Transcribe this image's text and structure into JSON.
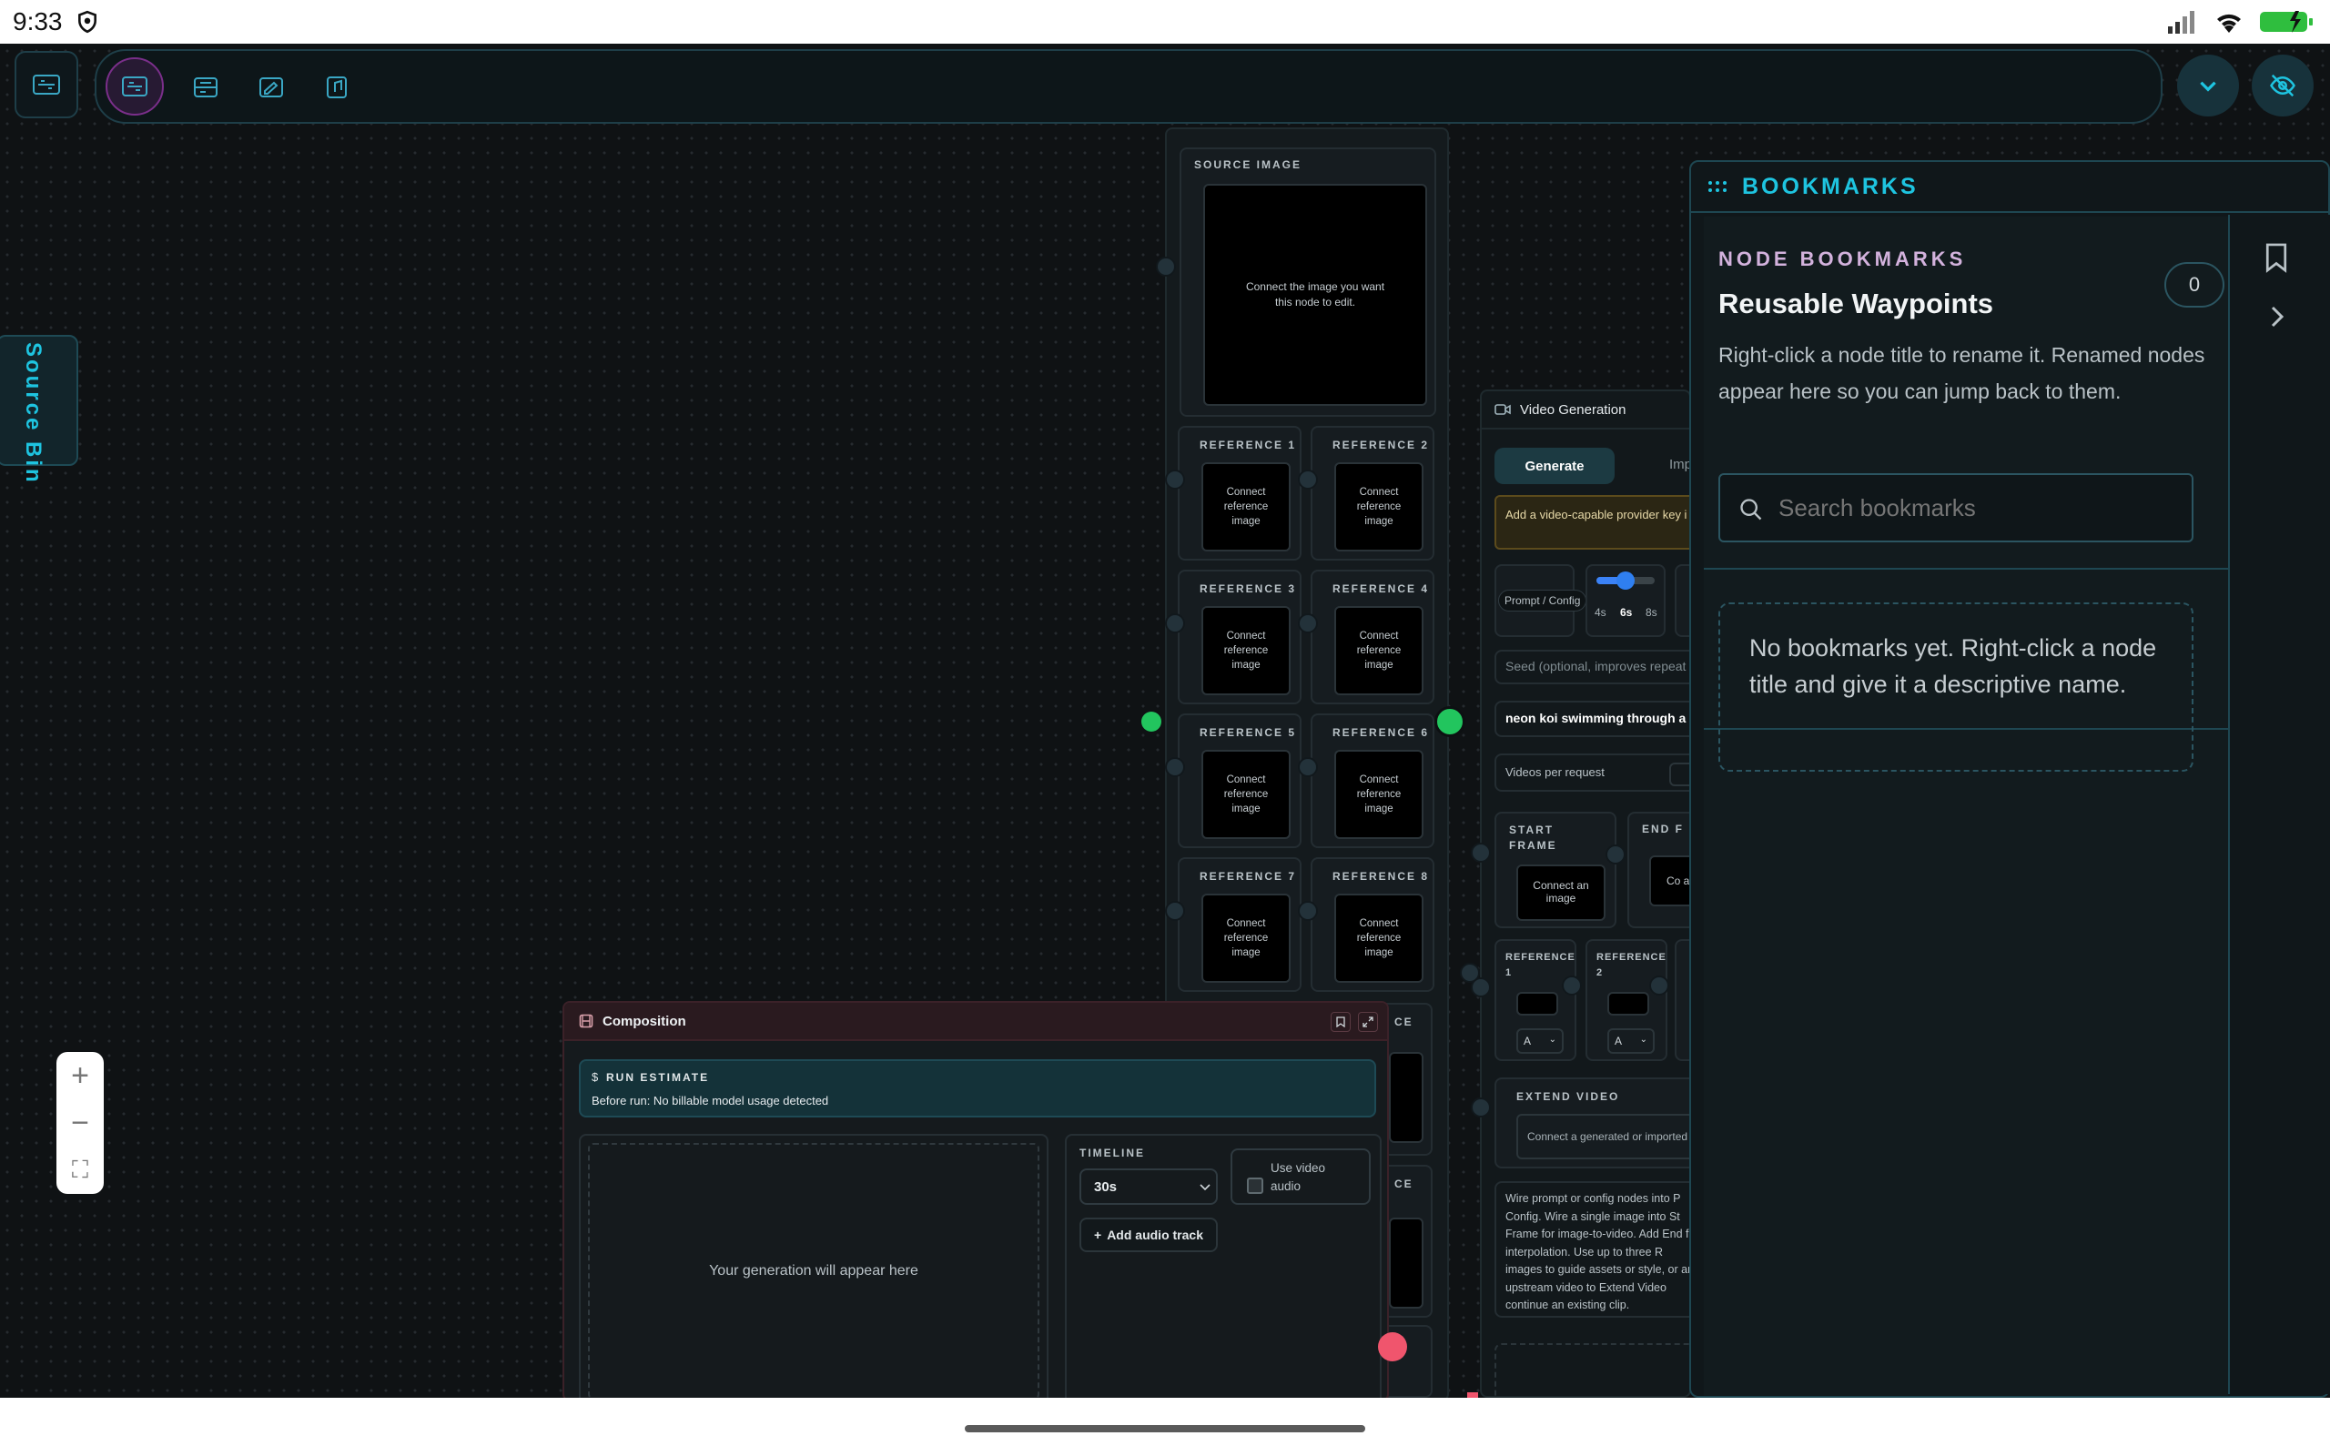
{
  "status_bar": {
    "time": "9:33"
  },
  "source_bin": {
    "label": "Source Bin"
  },
  "zoom": {
    "in": "+",
    "out": "−",
    "fit": "⛶"
  },
  "source_node": {
    "source_image_label": "SOURCE IMAGE",
    "source_image_hint": "Connect the image you want this node to edit.",
    "references": [
      {
        "label": "REFERENCE 1",
        "hint": "Connect reference image"
      },
      {
        "label": "REFERENCE 2",
        "hint": "Connect reference image"
      },
      {
        "label": "REFERENCE 3",
        "hint": "Connect reference image"
      },
      {
        "label": "REFERENCE 4",
        "hint": "Connect reference image"
      },
      {
        "label": "REFERENCE 5",
        "hint": "Connect reference image"
      },
      {
        "label": "REFERENCE 6",
        "hint": "Connect reference image"
      },
      {
        "label": "REFERENCE 7",
        "hint": "Connect reference image"
      },
      {
        "label": "REFERENCE 8",
        "hint": "Connect reference image"
      }
    ],
    "partial_labels": [
      "CE",
      "CE"
    ]
  },
  "video_node": {
    "title": "Video Generation",
    "tabs": [
      "Generate",
      "Imp"
    ],
    "warning": "Add a video-capable provider key i Settings to unlock video generatio",
    "prompt_config": "Prompt / Config",
    "durations": [
      "4s",
      "6s",
      "8s"
    ],
    "selected_duration": "6s",
    "duration_level": 0.5,
    "seed_placeholder": "Seed (optional, improves repeat",
    "prompt_value": "neon koi swimming through a ra",
    "videos_per_request": "Videos per request",
    "start_frame": "START FRAME",
    "start_frame_hint": "Connect an image",
    "end_frame": "END F",
    "end_frame_hint": "Co an",
    "ref1": "REFERENCE 1",
    "ref2": "REFERENCE 2",
    "ref_select": "A",
    "extend_video": "EXTEND VIDEO",
    "extend_hint": "Connect a generated or imported",
    "help": "Wire prompt or config nodes into P Config. Wire a single image into St Frame for image-to-video. Add End for interpolation. Use up to three R images to guide assets or style, or an upstream video to Extend Video continue an existing clip."
  },
  "composition": {
    "title": "Composition",
    "estimate_label": "RUN ESTIMATE",
    "estimate_text": "Before run: No billable model usage detected",
    "preview": "Your generation will appear here",
    "timeline_label": "TIMELINE",
    "timeline_value": "30s",
    "use_video_audio": "Use video audio",
    "add_audio": "Add audio track"
  },
  "bookmarks": {
    "header": "BOOKMARKS",
    "section": "NODE BOOKMARKS",
    "title": "Reusable Waypoints",
    "count": "0",
    "description": "Right-click a node title to rename it. Renamed nodes appear here so you can jump back to them.",
    "search_placeholder": "Search bookmarks",
    "empty": "No bookmarks yet. Right-click a node title and give it a descriptive name."
  },
  "colors": {
    "accent": "#1ec4e0",
    "green": "#22c55e",
    "red": "#f0556d",
    "composition_header": "#3a1b22"
  }
}
